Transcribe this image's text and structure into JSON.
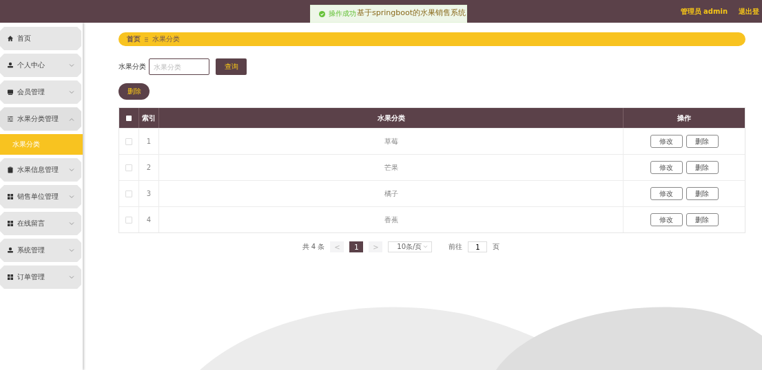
{
  "header": {
    "title": "基于springboot的水果销售系统",
    "user": "管理员 admin",
    "logout": "退出登"
  },
  "toast": {
    "text": "操作成功"
  },
  "sidebar": {
    "items": [
      {
        "label": "首页",
        "kind": "link"
      },
      {
        "label": "个人中心",
        "kind": "menu",
        "expanded": false
      },
      {
        "label": "会员管理",
        "kind": "menu",
        "expanded": false
      },
      {
        "label": "水果分类管理",
        "kind": "menu",
        "expanded": true,
        "children": [
          {
            "label": "水果分类",
            "selected": true
          }
        ]
      },
      {
        "label": "水果信息管理",
        "kind": "menu",
        "expanded": false
      },
      {
        "label": "销售单位管理",
        "kind": "menu",
        "expanded": false
      },
      {
        "label": "在线留言",
        "kind": "menu",
        "expanded": false
      },
      {
        "label": "系统管理",
        "kind": "menu",
        "expanded": false
      },
      {
        "label": "订单管理",
        "kind": "menu",
        "expanded": false
      }
    ]
  },
  "breadcrumb": [
    "首页",
    "水果分类"
  ],
  "search": {
    "label": "水果分类",
    "placeholder": "水果分类",
    "button": "查询"
  },
  "delete_button": "删除",
  "table": {
    "all_checked": false,
    "columns": [
      "索引",
      "水果分类",
      "操作"
    ],
    "rows": [
      {
        "index": "1",
        "name": "草莓",
        "checked": false,
        "actions": [
          "修改",
          "删除"
        ]
      },
      {
        "index": "2",
        "name": "芒果",
        "checked": false,
        "actions": [
          "修改",
          "删除"
        ]
      },
      {
        "index": "3",
        "name": "橘子",
        "checked": false,
        "actions": [
          "修改",
          "删除"
        ]
      },
      {
        "index": "4",
        "name": "香蕉",
        "checked": false,
        "actions": [
          "修改",
          "删除"
        ]
      }
    ]
  },
  "pagination": {
    "total": "共 4 条",
    "prev": "<",
    "pages": [
      {
        "label": "1",
        "selected": true
      }
    ],
    "next": ">",
    "page_size": "10条/页",
    "goto_label": "前往",
    "goto_value": "1",
    "goto_suffix": "页"
  }
}
